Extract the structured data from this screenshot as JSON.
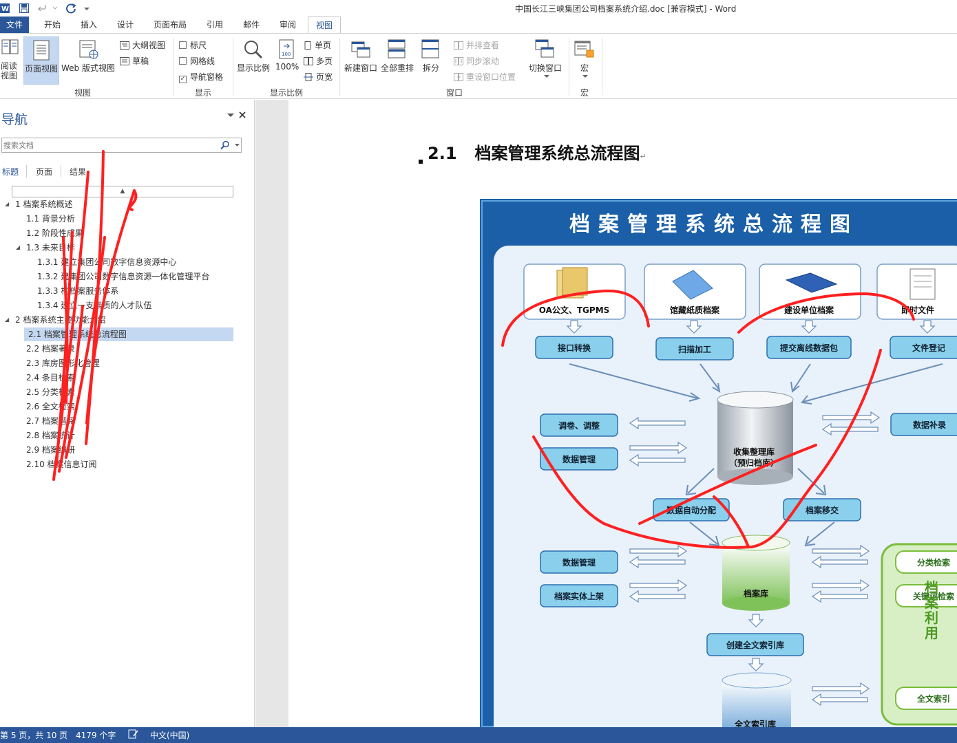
{
  "window": {
    "title": "中国长江三峡集团公司档案系统介绍.doc [兼容模式] - Word"
  },
  "ribbon_tabs": [
    "文件",
    "开始",
    "插入",
    "设计",
    "页面布局",
    "引用",
    "邮件",
    "审阅",
    "视图"
  ],
  "active_tab": "视图",
  "ribbon": {
    "view": {
      "read_mode": "阅读\n视图",
      "print_layout": "页面视图",
      "web_layout": "Web 版式视图",
      "outline": "大纲视图",
      "draft": "草稿",
      "group": "视图"
    },
    "show": {
      "ruler": "标尺",
      "gridlines": "网格线",
      "nav_pane": "导航窗格",
      "group": "显示",
      "ruler_checked": false,
      "gridlines_checked": false,
      "nav_pane_checked": true
    },
    "zoom": {
      "zoom": "显示比例",
      "hundred": "100%",
      "one_page": "单页",
      "multi_page": "多页",
      "page_width": "页宽",
      "group": "显示比例"
    },
    "window": {
      "new_window": "新建窗口",
      "arrange_all": "全部重排",
      "split": "拆分",
      "side_by_side": "并排查看",
      "sync_scroll": "同步滚动",
      "reset_pos": "重设窗口位置",
      "switch": "切换窗口",
      "group": "窗口"
    },
    "macros": {
      "macros": "宏",
      "group": "宏"
    }
  },
  "nav": {
    "title": "导航",
    "search_placeholder": "搜索文档",
    "tabs": [
      "标题",
      "页面",
      "结果"
    ],
    "headings": [
      {
        "level": 1,
        "text": "1 档案系统概述",
        "expanded": true
      },
      {
        "level": 2,
        "text": "1.1 背景分析"
      },
      {
        "level": 2,
        "text": "1.2 阶段性成果"
      },
      {
        "level": 2,
        "text": "1.3 未来目标",
        "expanded": true
      },
      {
        "level": 3,
        "text": "1.3.1 建立集团公司数字信息资源中心"
      },
      {
        "level": 3,
        "text": "1.3.2 建集团公司数字信息资源一体化管理平台"
      },
      {
        "level": 3,
        "text": "1.3.3 构档案服务体系"
      },
      {
        "level": 3,
        "text": "1.3.4 建立一支素质的人才队伍"
      },
      {
        "level": 1,
        "text": "2 档案系统主要功能介绍",
        "expanded": true
      },
      {
        "level": 2,
        "text": "2.1 档案管理系统总流程图",
        "selected": true
      },
      {
        "level": 2,
        "text": "2.2 档案著录"
      },
      {
        "level": 2,
        "text": "2.3 库房图形化管理"
      },
      {
        "level": 2,
        "text": "2.4 条目检索"
      },
      {
        "level": 2,
        "text": "2.5 分类检索"
      },
      {
        "level": 2,
        "text": "2.6 全文检索"
      },
      {
        "level": 2,
        "text": "2.7 档案借阅"
      },
      {
        "level": 2,
        "text": "2.8 档案统计"
      },
      {
        "level": 2,
        "text": "2.9 档案编研"
      },
      {
        "level": 2,
        "text": "2.10 档案信息订阅"
      }
    ]
  },
  "document": {
    "heading_number": "2.1",
    "heading_text": "档案管理系统总流程图",
    "flowchart": {
      "title": "档案管理系统总流程图",
      "sources": [
        "OA公文、TGPMS",
        "馆藏纸质档案",
        "建设单位档案",
        "即时文件"
      ],
      "steps": [
        "接口转换",
        "扫描加工",
        "提交离线数据包",
        "文件登记"
      ],
      "left_ops_1": [
        "调卷、调整",
        "数据管理"
      ],
      "right_ops_1": [
        "数据补录"
      ],
      "db_collect": [
        "收集整理库",
        "（预归档库）"
      ],
      "mid_ops": [
        "数据自动分配",
        "档案移交"
      ],
      "left_ops_2": [
        "数据管理",
        "档案实体上架"
      ],
      "db_archive": "档案库",
      "index_op": "创建全文索引库",
      "db_index": "全文索引库",
      "use_panel": {
        "title": "档案利用",
        "items": [
          "分类检索",
          "关键词检索",
          "全文索引"
        ]
      }
    }
  },
  "status": {
    "page": "第 5 页，共 10 页",
    "words": "4179 个字",
    "language": "中文(中国)"
  },
  "colors": {
    "accent": "#2b579a",
    "chart_bg": "#1a5fa8",
    "chart_panel": "#e9f1fb",
    "box_fill": "#8ad0ec",
    "annotation": "#ff2020",
    "green": "#7bbd3a"
  }
}
